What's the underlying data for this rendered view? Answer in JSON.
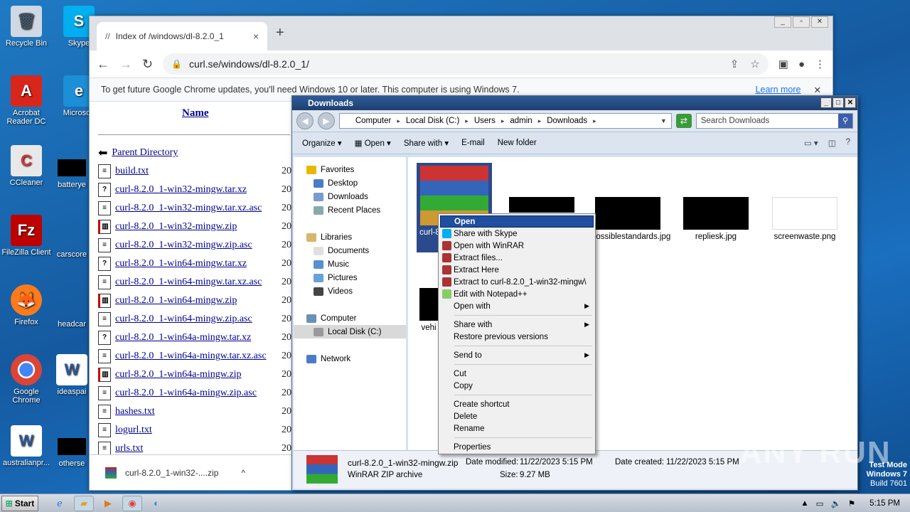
{
  "desktop": {
    "icons": [
      {
        "label": "Recycle Bin"
      },
      {
        "label": "Skype"
      },
      {
        "label": "Acrobat Reader DC"
      },
      {
        "label": "Microsoft"
      },
      {
        "label": "CCleaner"
      },
      {
        "label": "batterye"
      },
      {
        "label": "FileZilla Client"
      },
      {
        "label": "carscore"
      },
      {
        "label": "Firefox"
      },
      {
        "label": "headcar"
      },
      {
        "label": "Google Chrome"
      },
      {
        "label": "ideaspai"
      },
      {
        "label": "australianpr..."
      },
      {
        "label": "otherse"
      }
    ],
    "watermark_line1": "Test Mode",
    "watermark_line2": "Windows 7",
    "watermark_line3": "Build 7601",
    "brand": "ANY RUN"
  },
  "chrome": {
    "tab_title": "Index of /windows/dl-8.2.0_1",
    "tab_close": "×",
    "new_tab": "+",
    "url": "curl.se/windows/dl-8.2.0_1/",
    "infobar_text": "To get future Google Chrome updates, you'll need Windows 10 or later. This computer is using Windows 7.",
    "infobar_link": "Learn more",
    "infobar_close": "✕",
    "listing": {
      "header_name": "Name",
      "parent": "Parent Directory",
      "files": [
        {
          "name": "build.txt",
          "icon": "doc",
          "date": "20"
        },
        {
          "name": "curl-8.2.0_1-win32-mingw.tar.xz",
          "icon": "unknown",
          "date": "20"
        },
        {
          "name": "curl-8.2.0_1-win32-mingw.tar.xz.asc",
          "icon": "doc",
          "date": "20"
        },
        {
          "name": "curl-8.2.0_1-win32-mingw.zip",
          "icon": "zip",
          "date": "20"
        },
        {
          "name": "curl-8.2.0_1-win32-mingw.zip.asc",
          "icon": "doc",
          "date": "20"
        },
        {
          "name": "curl-8.2.0_1-win64-mingw.tar.xz",
          "icon": "unknown",
          "date": "20"
        },
        {
          "name": "curl-8.2.0_1-win64-mingw.tar.xz.asc",
          "icon": "doc",
          "date": "20"
        },
        {
          "name": "curl-8.2.0_1-win64-mingw.zip",
          "icon": "zip",
          "date": "20"
        },
        {
          "name": "curl-8.2.0_1-win64-mingw.zip.asc",
          "icon": "doc",
          "date": "20"
        },
        {
          "name": "curl-8.2.0_1-win64a-mingw.tar.xz",
          "icon": "unknown",
          "date": "20"
        },
        {
          "name": "curl-8.2.0_1-win64a-mingw.tar.xz.asc",
          "icon": "doc",
          "date": "20"
        },
        {
          "name": "curl-8.2.0_1-win64a-mingw.zip",
          "icon": "zip",
          "date": "20"
        },
        {
          "name": "curl-8.2.0_1-win64a-mingw.zip.asc",
          "icon": "doc",
          "date": "20"
        },
        {
          "name": "hashes.txt",
          "icon": "doc",
          "date": "20"
        },
        {
          "name": "logurl.txt",
          "icon": "doc",
          "date": "20"
        },
        {
          "name": "urls.txt",
          "icon": "doc",
          "date": "20"
        }
      ]
    },
    "download_item": "curl-8.2.0_1-win32-....zip",
    "download_chevron": "^"
  },
  "explorer": {
    "title": "Downloads",
    "breadcrumbs": [
      "Computer",
      "Local Disk (C:)",
      "Users",
      "admin",
      "Downloads"
    ],
    "search_placeholder": "Search Downloads",
    "commands": {
      "organize": "Organize",
      "open": "Open",
      "share": "Share with",
      "email": "E-mail",
      "newfolder": "New folder"
    },
    "nav": {
      "favorites": "Favorites",
      "desktop": "Desktop",
      "downloads": "Downloads",
      "recent": "Recent Places",
      "libraries": "Libraries",
      "documents": "Documents",
      "music": "Music",
      "pictures": "Pictures",
      "videos": "Videos",
      "computer": "Computer",
      "localdisk": "Local Disk (C:)",
      "network": "Network"
    },
    "files": {
      "selected_label": "curl-8",
      "f2": "possiblestandards.jpg",
      "f3": "repliesk.jpg",
      "f4": "screenwaste.png",
      "f5": "vehi"
    },
    "details": {
      "filename": "curl-8.2.0_1-win32-mingw.zip",
      "type": "WinRAR ZIP archive",
      "modified_label": "Date modified:",
      "modified": "11/22/2023 5:15 PM",
      "size_label": "Size:",
      "size": "9.27 MB",
      "created_label": "Date created:",
      "created": "11/22/2023 5:15 PM"
    }
  },
  "context_menu": {
    "open": "Open",
    "skype": "Share with Skype",
    "winrar": "Open with WinRAR",
    "extract_files": "Extract files...",
    "extract_here": "Extract Here",
    "extract_to": "Extract to curl-8.2.0_1-win32-mingw\\",
    "notepad": "Edit with Notepad++",
    "open_with": "Open with",
    "share_with": "Share with",
    "restore": "Restore previous versions",
    "send_to": "Send to",
    "cut": "Cut",
    "copy": "Copy",
    "shortcut": "Create shortcut",
    "delete": "Delete",
    "rename": "Rename",
    "properties": "Properties"
  },
  "taskbar": {
    "start": "Start",
    "clock": "5:15 PM"
  }
}
